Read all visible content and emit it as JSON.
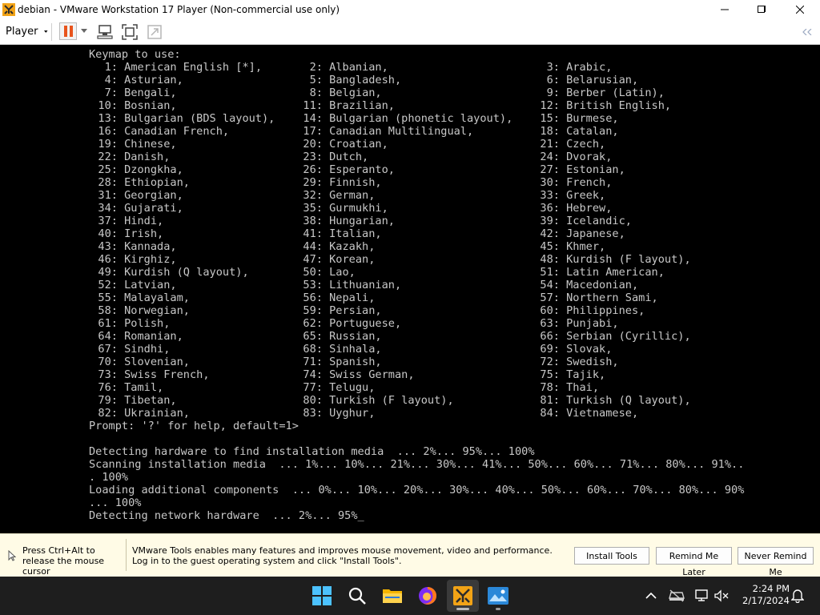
{
  "window": {
    "title": "debian - VMware Workstation 17 Player (Non-commercial use only)"
  },
  "toolbar": {
    "player_label": "Player",
    "icons": [
      "pause-icon",
      "send-ctrl-alt-del-icon",
      "fullscreen-icon",
      "unity-icon",
      "collapse-icon"
    ]
  },
  "console": {
    "keymap_header": "Keymap to use:",
    "keymaps": [
      "1: American English [*],",
      "2: Albanian,",
      "3: Arabic,",
      "4: Asturian,",
      "5: Bangladesh,",
      "6: Belarusian,",
      "7: Bengali,",
      "8: Belgian,",
      "9: Berber (Latin),",
      "10: Bosnian,",
      "11: Brazilian,",
      "12: British English,",
      "13: Bulgarian (BDS layout),",
      "14: Bulgarian (phonetic layout),",
      "15: Burmese,",
      "16: Canadian French,",
      "17: Canadian Multilingual,",
      "18: Catalan,",
      "19: Chinese,",
      "20: Croatian,",
      "21: Czech,",
      "22: Danish,",
      "23: Dutch,",
      "24: Dvorak,",
      "25: Dzongkha,",
      "26: Esperanto,",
      "27: Estonian,",
      "28: Ethiopian,",
      "29: Finnish,",
      "30: French,",
      "31: Georgian,",
      "32: German,",
      "33: Greek,",
      "34: Gujarati,",
      "35: Gurmukhi,",
      "36: Hebrew,",
      "37: Hindi,",
      "38: Hungarian,",
      "39: Icelandic,",
      "40: Irish,",
      "41: Italian,",
      "42: Japanese,",
      "43: Kannada,",
      "44: Kazakh,",
      "45: Khmer,",
      "46: Kirghiz,",
      "47: Korean,",
      "48: Kurdish (F layout),",
      "49: Kurdish (Q layout),",
      "50: Lao,",
      "51: Latin American,",
      "52: Latvian,",
      "53: Lithuanian,",
      "54: Macedonian,",
      "55: Malayalam,",
      "56: Nepali,",
      "57: Northern Sami,",
      "58: Norwegian,",
      "59: Persian,",
      "60: Philippines,",
      "61: Polish,",
      "62: Portuguese,",
      "63: Punjabi,",
      "64: Romanian,",
      "65: Russian,",
      "66: Serbian (Cyrillic),",
      "67: Sindhi,",
      "68: Sinhala,",
      "69: Slovak,",
      "70: Slovenian,",
      "71: Spanish,",
      "72: Swedish,",
      "73: Swiss French,",
      "74: Swiss German,",
      "75: Tajik,",
      "76: Tamil,",
      "77: Telugu,",
      "78: Thai,",
      "79: Tibetan,",
      "80: Turkish (F layout),",
      "81: Turkish (Q layout),",
      "82: Ukrainian,",
      "83: Uyghur,",
      "84: Vietnamese,"
    ],
    "prompt": "Prompt: '?' for help, default=1>",
    "log": [
      "Detecting hardware to find installation media  ... 2%... 95%... 100%",
      "Scanning installation media  ... 1%... 10%... 21%... 30%... 41%... 50%... 60%... 71%... 80%... 91%..",
      ". 100%",
      "Loading additional components  ... 0%... 10%... 20%... 30%... 40%... 50%... 60%... 70%... 80%... 90%",
      "... 100%",
      "Detecting network hardware  ... 2%... 95%_"
    ]
  },
  "notification": {
    "hint": "Press Ctrl+Alt to release the mouse cursor",
    "message": "VMware Tools enables many features and improves mouse movement, video and performance. Log in to the guest operating system and click \"Install Tools\".",
    "buttons": {
      "install": "Install Tools",
      "remind_later": "Remind Me Later",
      "never_remind": "Never Remind Me"
    }
  },
  "taskbar": {
    "apps": [
      "windows-start-icon",
      "search-icon",
      "file-explorer-icon",
      "firefox-icon",
      "vmware-player-icon",
      "photos-icon"
    ],
    "clock": {
      "time": "2:24 PM",
      "date": "2/17/2024"
    }
  },
  "colors": {
    "console_bg": "#000000",
    "console_text": "#c8c8c8",
    "notify_bg": "#fffbe6",
    "taskbar_bg": "#1e1e1e",
    "pause_orange": "#e8541c"
  }
}
